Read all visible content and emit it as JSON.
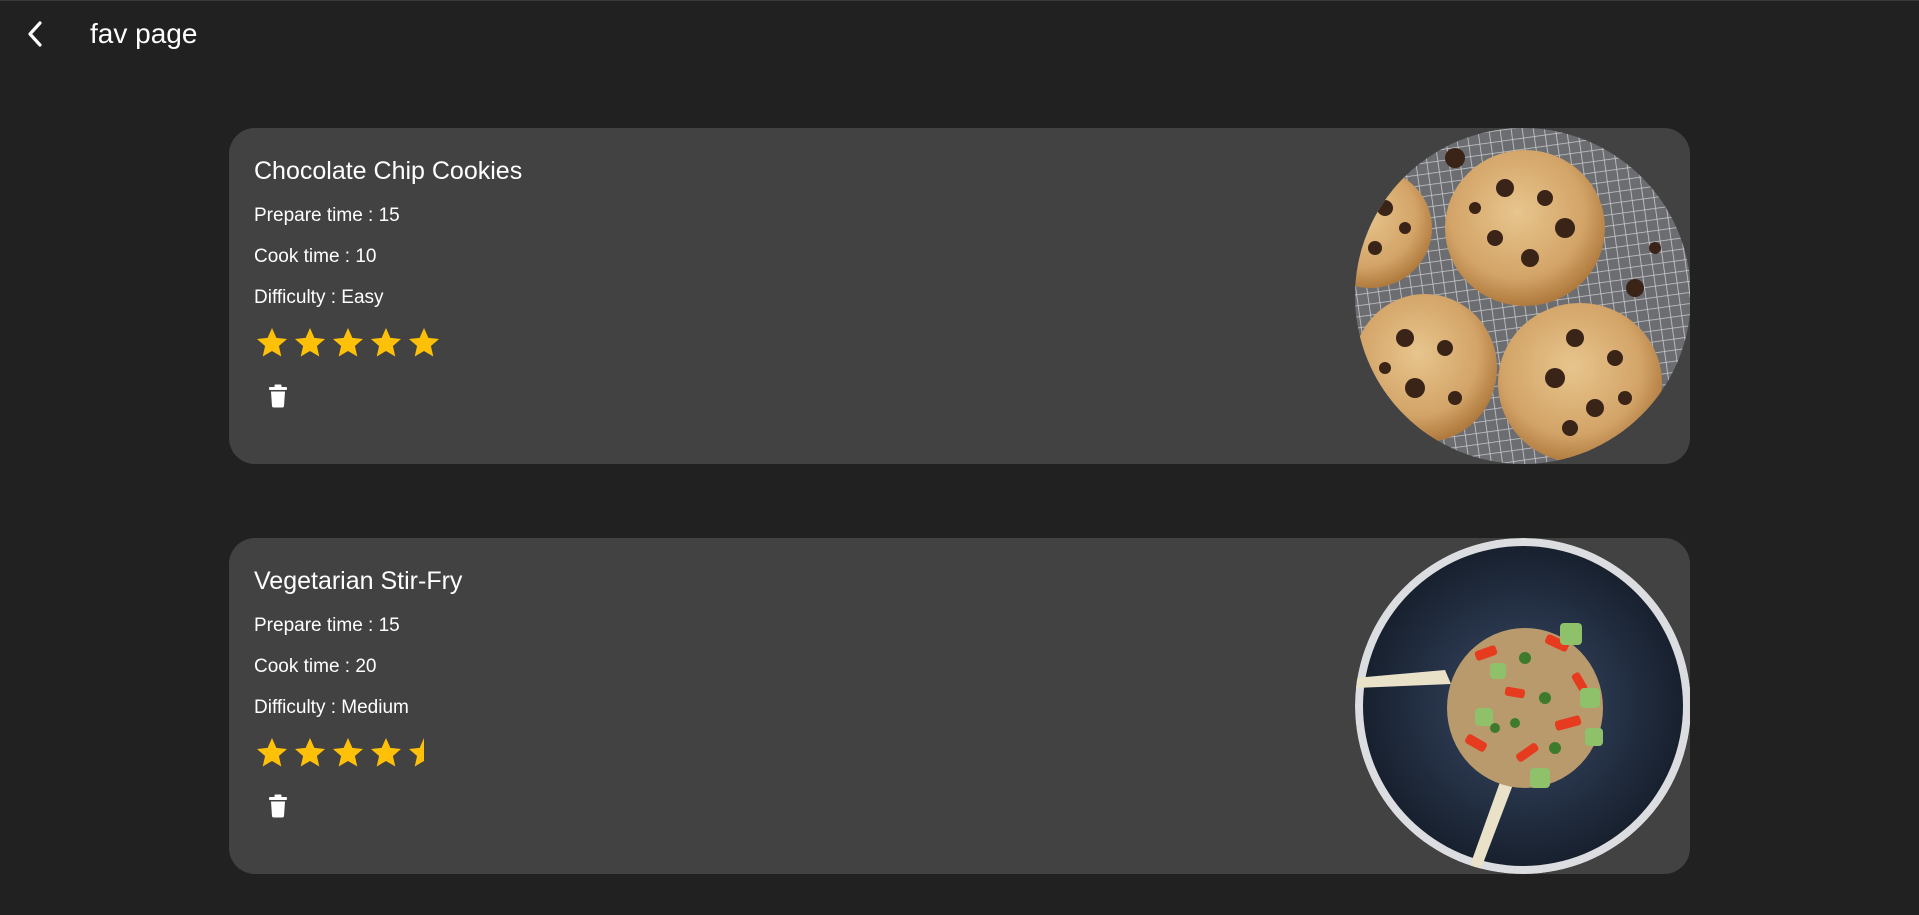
{
  "appbar": {
    "title": "fav page",
    "back_icon": "arrow-back-icon"
  },
  "colors": {
    "background": "#212121",
    "card": "#424242",
    "star": "#FFC107",
    "text": "#FFFFFF"
  },
  "favorites": [
    {
      "name": "Chocolate Chip Cookies",
      "prepare_time": "Prepare time : 15",
      "cook_time": "Cook time : 10",
      "difficulty": "Difficulty : Easy",
      "rating": 5,
      "rating_max": 5,
      "delete_icon": "trash-icon",
      "image": "cookies-on-cooling-rack-photo"
    },
    {
      "name": "Vegetarian Stir-Fry",
      "prepare_time": "Prepare time : 15",
      "cook_time": "Cook time : 20",
      "difficulty": "Difficulty : Medium",
      "rating": 4.5,
      "rating_max": 5,
      "delete_icon": "trash-icon",
      "image": "stir-fry-in-bowl-photo"
    }
  ]
}
